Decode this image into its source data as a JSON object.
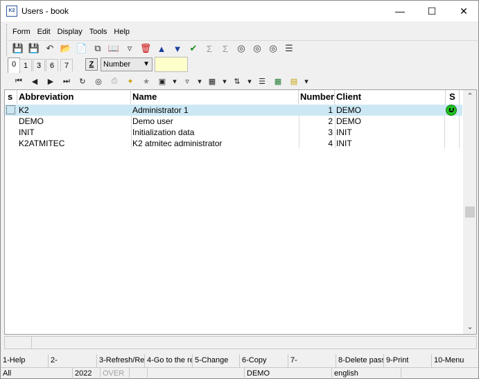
{
  "window": {
    "title": "Users - book",
    "app_icon_text": "K2"
  },
  "menu": [
    "Form",
    "Edit",
    "Display",
    "Tools",
    "Help"
  ],
  "toolbar_icons": [
    "save-icon",
    "save-close-icon",
    "undo-icon",
    "open-folder-icon",
    "new-document-icon",
    "copy-icon",
    "book-icon",
    "filter-icon",
    "document-delete-icon",
    "arrow-up-icon",
    "arrow-down-icon",
    "check-mark-icon",
    "sigma-icon",
    "sigma-down-icon",
    "binoculars-icon",
    "binoculars-next-icon",
    "binoculars-find-icon",
    "menu-lines-icon"
  ],
  "tabs": [
    "0",
    "1",
    "3",
    "6",
    "7"
  ],
  "sort_combo": {
    "label": "Z",
    "value": "Number"
  },
  "nav_icons": [
    "first-record-icon",
    "previous-record-icon",
    "next-record-icon",
    "last-record-icon",
    "refresh-icon",
    "find-icon",
    "print-icon",
    "wand-icon",
    "star-icon",
    "camera-icon",
    "filter-icon",
    "columns-icon",
    "sort-az-icon",
    "list-icon",
    "excel-icon",
    "report-icon"
  ],
  "grid": {
    "columns": [
      {
        "key": "s",
        "label": "s"
      },
      {
        "key": "abbreviation",
        "label": "Abbreviation"
      },
      {
        "key": "name",
        "label": "Name"
      },
      {
        "key": "number",
        "label": "Number"
      },
      {
        "key": "client",
        "label": "Client"
      },
      {
        "key": "S",
        "label": "S"
      }
    ],
    "rows": [
      {
        "abbreviation": "K2",
        "name": "Administrator 1",
        "number": "1",
        "client": "DEMO",
        "status_icon": "smiley-icon"
      },
      {
        "abbreviation": "DEMO",
        "name": "Demo user",
        "number": "2",
        "client": "DEMO"
      },
      {
        "abbreviation": "INIT",
        "name": "Initialization data",
        "number": "3",
        "client": "INIT"
      },
      {
        "abbreviation": "K2ATMITEC",
        "name": "K2 atmitec administrator",
        "number": "4",
        "client": "INIT"
      }
    ]
  },
  "fkeys": [
    "1-Help",
    "2-",
    "3-Refresh/Re",
    "4-Go to the re",
    "5-Change",
    "6-Copy",
    "7-",
    "8-Delete pass",
    "9-Print",
    "10-Menu"
  ],
  "status": {
    "scope": "All",
    "year": "2022",
    "mode": "OVER",
    "client": "DEMO",
    "language": "english"
  },
  "colors": {
    "selected_row": "#cce8f4",
    "status_ok": "#22c022",
    "filter_box": "#ffffcc"
  }
}
